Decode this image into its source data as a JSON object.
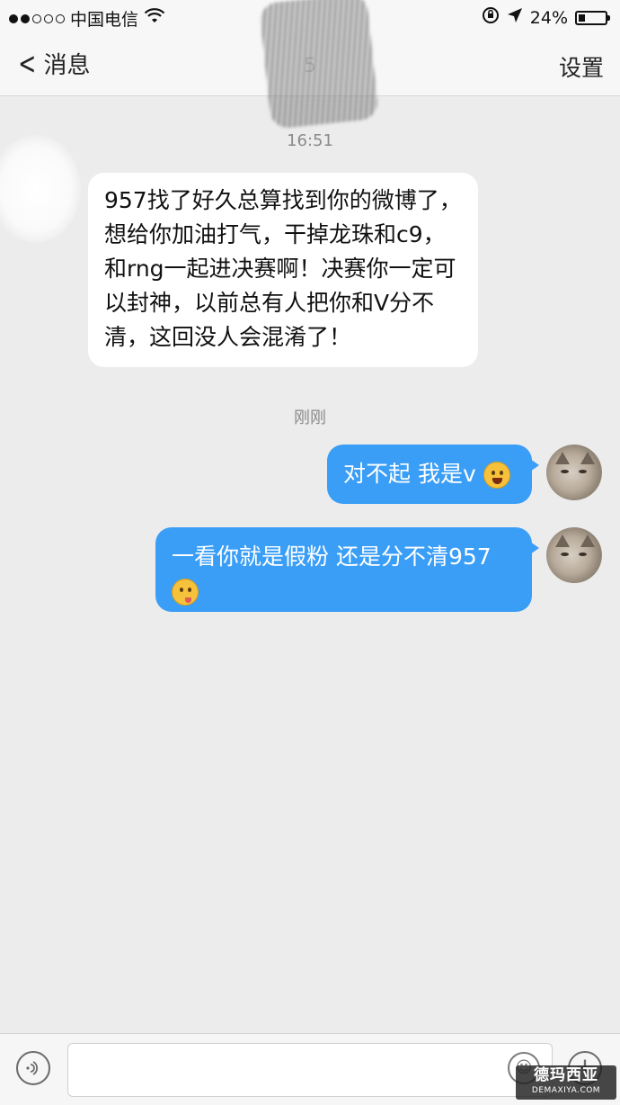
{
  "status_bar": {
    "carrier": "中国电信",
    "battery_percent": "24%",
    "battery_level": 0.24,
    "icons": [
      "signal-dots-icon",
      "wifi-icon",
      "orientation-lock-icon",
      "location-arrow-icon",
      "battery-icon"
    ]
  },
  "nav": {
    "back_label": "消息",
    "title_fragment": "5",
    "settings_label": "设置"
  },
  "chat": {
    "time_1": "16:51",
    "incoming_message": "957找了好久总算找到你的微博了，想给你加油打气，干掉龙珠和c9，和rng一起进决赛啊！决赛你一定可以封神，以前总有人把你和V分不清，这回没人会混淆了！",
    "time_2": "刚刚",
    "outgoing_1": "对不起 我是v",
    "outgoing_2": "一看你就是假粉 还是分不清957"
  },
  "input_bar": {
    "placeholder": "",
    "icons": [
      "voice-icon",
      "emoji-icon",
      "plus-icon"
    ]
  },
  "watermark": {
    "main": "德玛西亚",
    "sub": "DEMAXIYA.COM"
  },
  "colors": {
    "bubble_out": "#3a9ef7",
    "bubble_in": "#ffffff",
    "background": "#ececec"
  }
}
